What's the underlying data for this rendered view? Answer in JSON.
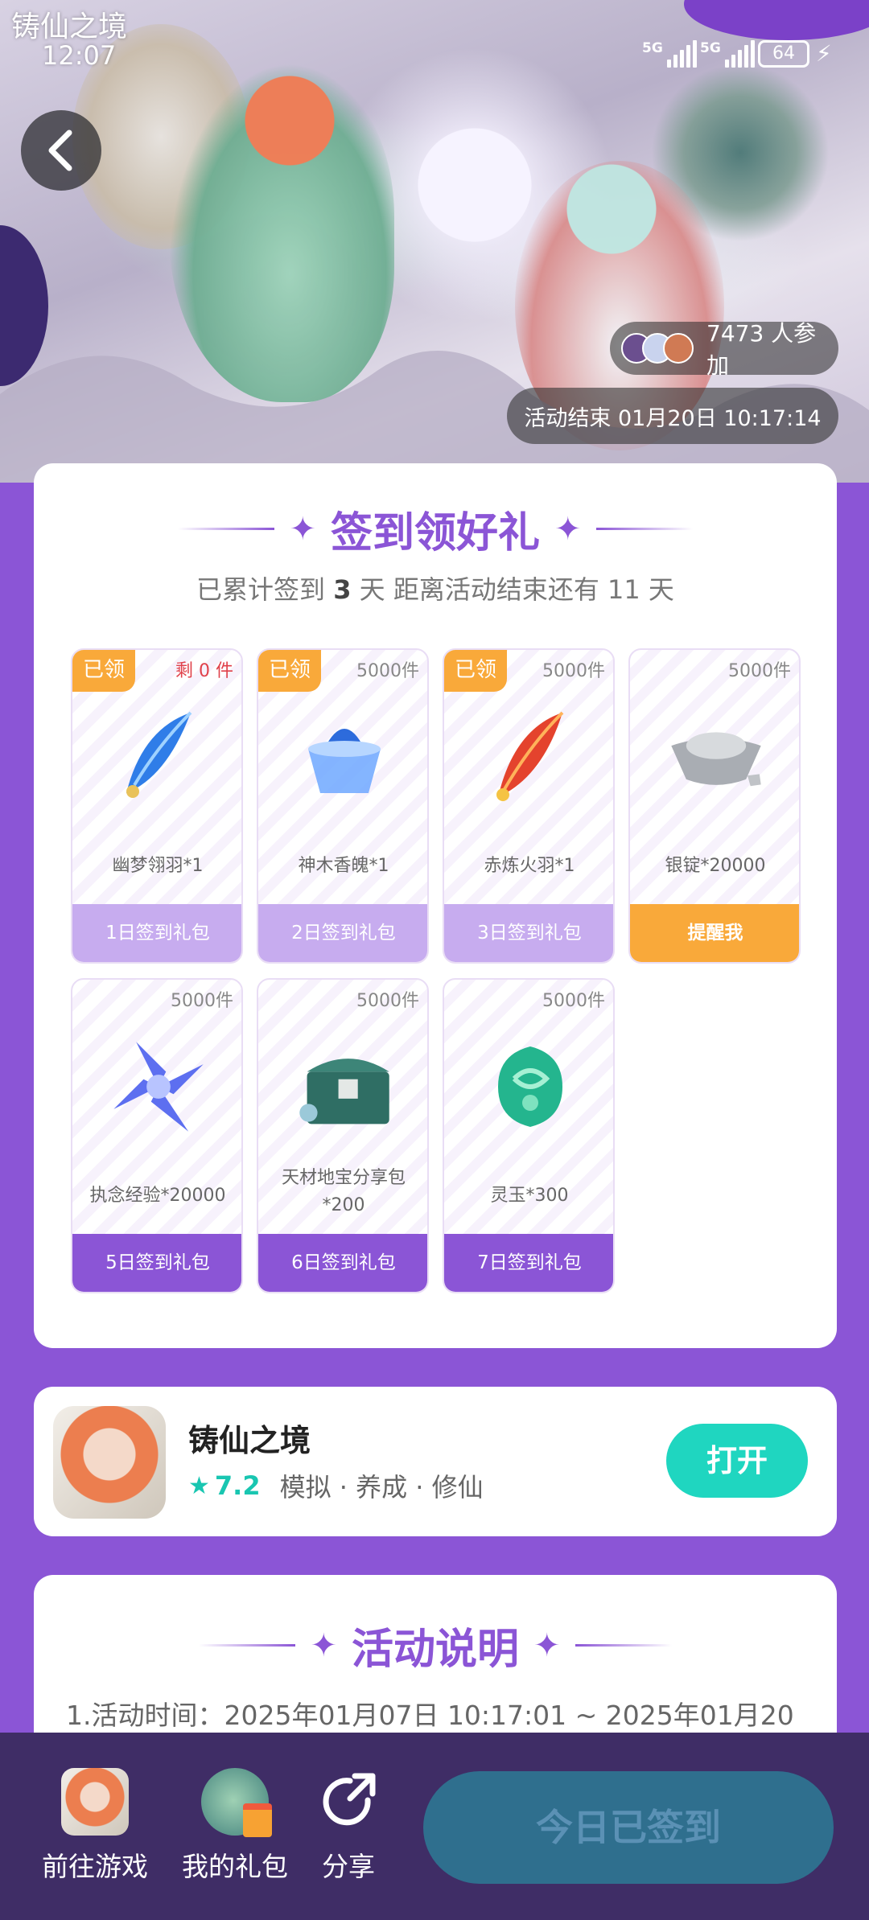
{
  "status_bar": {
    "logo_text": "铸仙之境",
    "time": "12:07",
    "network1": "5G",
    "network2": "5G",
    "battery": "64"
  },
  "hero": {
    "participants_count": "7473",
    "participants_suffix": "人参加",
    "end_time": "活动结束 01月20日 10:17:14"
  },
  "signin": {
    "title": "签到领好礼",
    "progress_prefix": "已累计签到",
    "signed_days": "3",
    "progress_mid": "天  距离活动结束还有",
    "remaining_days": "11",
    "progress_suffix": "天",
    "gifts": [
      {
        "badge": "已领",
        "stock": "剩 0 件",
        "name": "幽梦翎羽*1",
        "footer": "1日签到礼包",
        "state": "claimed"
      },
      {
        "badge": "已领",
        "stock": "5000件",
        "name": "神木香魄*1",
        "footer": "2日签到礼包",
        "state": "claimed"
      },
      {
        "badge": "已领",
        "stock": "5000件",
        "name": "赤炼火羽*1",
        "footer": "3日签到礼包",
        "state": "claimed"
      },
      {
        "badge": "",
        "stock": "5000件",
        "name": "银锭*20000",
        "footer": "提醒我",
        "state": "remind"
      },
      {
        "badge": "",
        "stock": "5000件",
        "name": "执念经验*20000",
        "footer": "5日签到礼包",
        "state": "future"
      },
      {
        "badge": "",
        "stock": "5000件",
        "name": "天材地宝分享包",
        "name2": "*200",
        "footer": "6日签到礼包",
        "state": "future"
      },
      {
        "badge": "",
        "stock": "5000件",
        "name": "灵玉*300",
        "footer": "7日签到礼包",
        "state": "future"
      }
    ]
  },
  "game": {
    "name": "铸仙之境",
    "rating": "7.2",
    "tags": "模拟 · 养成 · 修仙",
    "open_label": "打开"
  },
  "rules": {
    "title": "活动说明",
    "line1": "1.活动时间：2025年01月07日 10:17:01 ~ 2025年01月20"
  },
  "bottom_bar": {
    "goto_game": "前往游戏",
    "my_gifts": "我的礼包",
    "share": "分享",
    "checked_in": "今日已签到"
  },
  "colors": {
    "primary": "#8b55d6",
    "accent": "#1fd6c0",
    "orange": "#f9a93a",
    "bar": "#3f2d66"
  }
}
